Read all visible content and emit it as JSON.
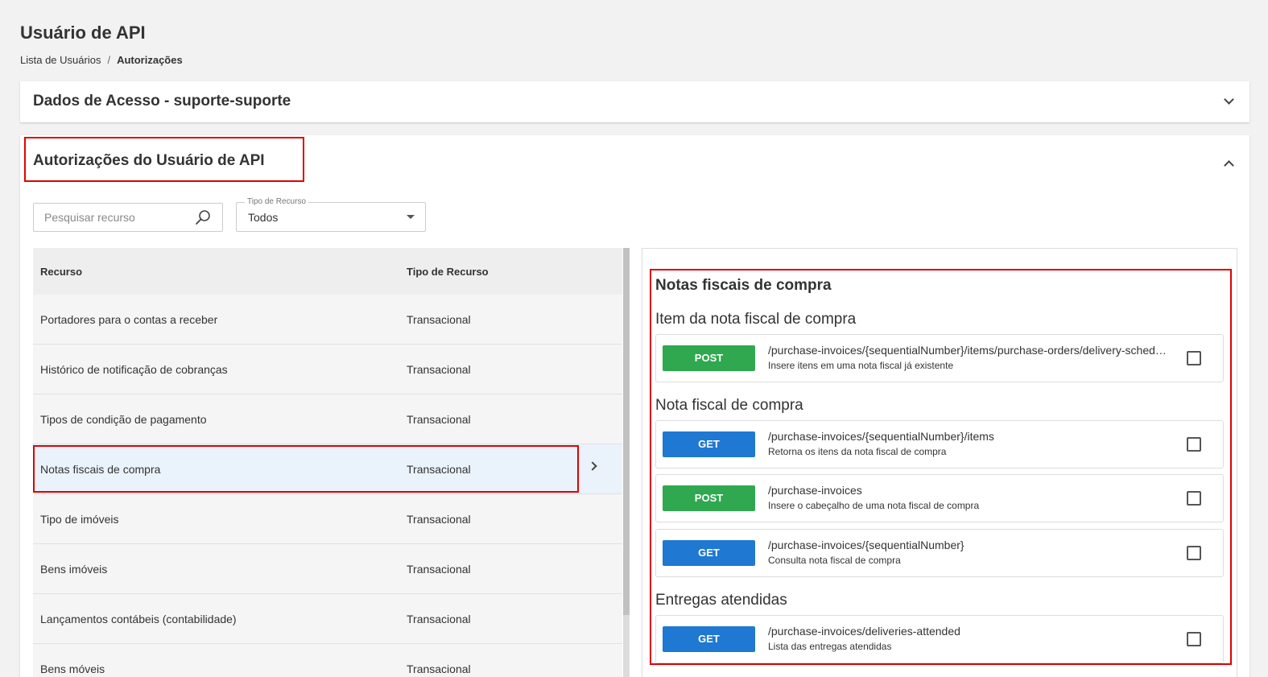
{
  "page": {
    "title": "Usuário de API",
    "breadcrumb": {
      "parent": "Lista de Usuários",
      "separator": "/",
      "current": "Autorizações"
    }
  },
  "access_card": {
    "title": "Dados de Acesso - suporte-suporte",
    "toggle_icon": "chevron-down-icon"
  },
  "auth_card": {
    "title": "Autorizações do Usuário de API",
    "toggle_icon": "chevron-up-icon",
    "search": {
      "placeholder": "Pesquisar recurso",
      "value": "",
      "icon": "search-icon"
    },
    "filter": {
      "label": "Tipo de Recurso",
      "value": "Todos"
    },
    "table": {
      "headers": [
        "Recurso",
        "Tipo de Recurso"
      ],
      "rows": [
        {
          "name": "Portadores para o contas a receber",
          "type": "Transacional"
        },
        {
          "name": "Histórico de notificação de cobranças",
          "type": "Transacional"
        },
        {
          "name": "Tipos de condição de pagamento",
          "type": "Transacional"
        },
        {
          "name": "Notas fiscais de compra",
          "type": "Transacional",
          "selected": true
        },
        {
          "name": "Tipo de imóveis",
          "type": "Transacional"
        },
        {
          "name": "Bens imóveis",
          "type": "Transacional"
        },
        {
          "name": "Lançamentos contábeis (contabilidade)",
          "type": "Transacional"
        },
        {
          "name": "Bens móveis",
          "type": "Transacional"
        }
      ]
    },
    "detail": {
      "title": "Notas fiscais de compra",
      "sections": [
        {
          "title": "Item da nota fiscal de compra",
          "endpoints": [
            {
              "method": "POST",
              "path": "/purchase-invoices/{sequentialNumber}/items/purchase-orders/delivery-schedules",
              "description": "Insere itens em uma nota fiscal já existente",
              "checked": false
            }
          ]
        },
        {
          "title": "Nota fiscal de compra",
          "endpoints": [
            {
              "method": "GET",
              "path": "/purchase-invoices/{sequentialNumber}/items",
              "description": "Retorna os itens da nota fiscal de compra",
              "checked": false
            },
            {
              "method": "POST",
              "path": "/purchase-invoices",
              "description": "Insere o cabeçalho de uma nota fiscal de compra",
              "checked": false
            },
            {
              "method": "GET",
              "path": "/purchase-invoices/{sequentialNumber}",
              "description": "Consulta nota fiscal de compra",
              "checked": false
            }
          ]
        },
        {
          "title": "Entregas atendidas",
          "endpoints": [
            {
              "method": "GET",
              "path": "/purchase-invoices/deliveries-attended",
              "description": "Lista das entregas atendidas",
              "checked": false
            }
          ]
        }
      ]
    }
  },
  "colors": {
    "post": "#2fa84f",
    "get": "#1f78d1",
    "highlight": "#e00000",
    "selected_row": "#eaf3fb"
  }
}
